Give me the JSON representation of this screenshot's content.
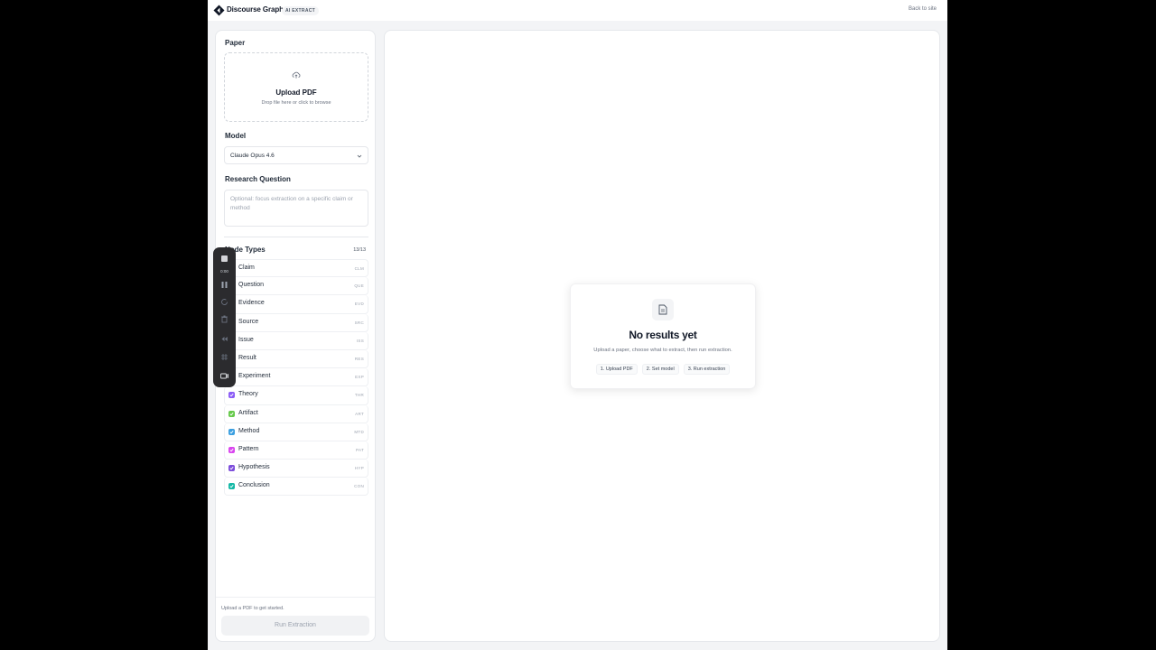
{
  "header": {
    "brand": "Discourse Graphs",
    "badge": "AI EXTRACT",
    "back_link": "Back to site"
  },
  "sidebar": {
    "paper": {
      "title": "Paper",
      "upload_title": "Upload PDF",
      "upload_hint": "Drop file here or click to browse"
    },
    "model": {
      "title": "Model",
      "selected": "Claude Opus 4.6"
    },
    "research_question": {
      "title": "Research Question",
      "placeholder": "Optional: focus extraction on a specific claim or method"
    },
    "node_types": {
      "title": "Node Types",
      "count": "13/13",
      "items": [
        {
          "label": "Claim",
          "abbr": "CLM",
          "color": "#6366f1"
        },
        {
          "label": "Question",
          "abbr": "QUE",
          "color": "#6366f1"
        },
        {
          "label": "Evidence",
          "abbr": "EVD",
          "color": "#22c55e"
        },
        {
          "label": "Source",
          "abbr": "SRC",
          "color": "#64748b"
        },
        {
          "label": "Issue",
          "abbr": "ISS",
          "color": "#ef4444"
        },
        {
          "label": "Result",
          "abbr": "RES",
          "color": "#3b82f6"
        },
        {
          "label": "Experiment",
          "abbr": "EXP",
          "color": "#f59e0b"
        },
        {
          "label": "Theory",
          "abbr": "THR",
          "color": "#8b5cf6"
        },
        {
          "label": "Artifact",
          "abbr": "ART",
          "color": "#65c94a"
        },
        {
          "label": "Method",
          "abbr": "MTD",
          "color": "#3b9fe0"
        },
        {
          "label": "Pattern",
          "abbr": "PAT",
          "color": "#d946ef"
        },
        {
          "label": "Hypothesis",
          "abbr": "HYP",
          "color": "#7c4ddb"
        },
        {
          "label": "Conclusion",
          "abbr": "CON",
          "color": "#14b8a6"
        }
      ]
    },
    "status": "Upload a PDF to get started.",
    "run_button": "Run Extraction"
  },
  "recorder": {
    "time": "0:00",
    "icons": [
      "stop-icon",
      "pause-icon",
      "restart-icon",
      "trash-icon",
      "rewind-icon",
      "grid-icon",
      "camera-icon"
    ]
  },
  "main": {
    "empty": {
      "title": "No results yet",
      "subtitle": "Upload a paper, choose what to extract, then run extraction.",
      "steps": [
        "1. Upload PDF",
        "2. Set model",
        "3. Run extraction"
      ]
    }
  }
}
